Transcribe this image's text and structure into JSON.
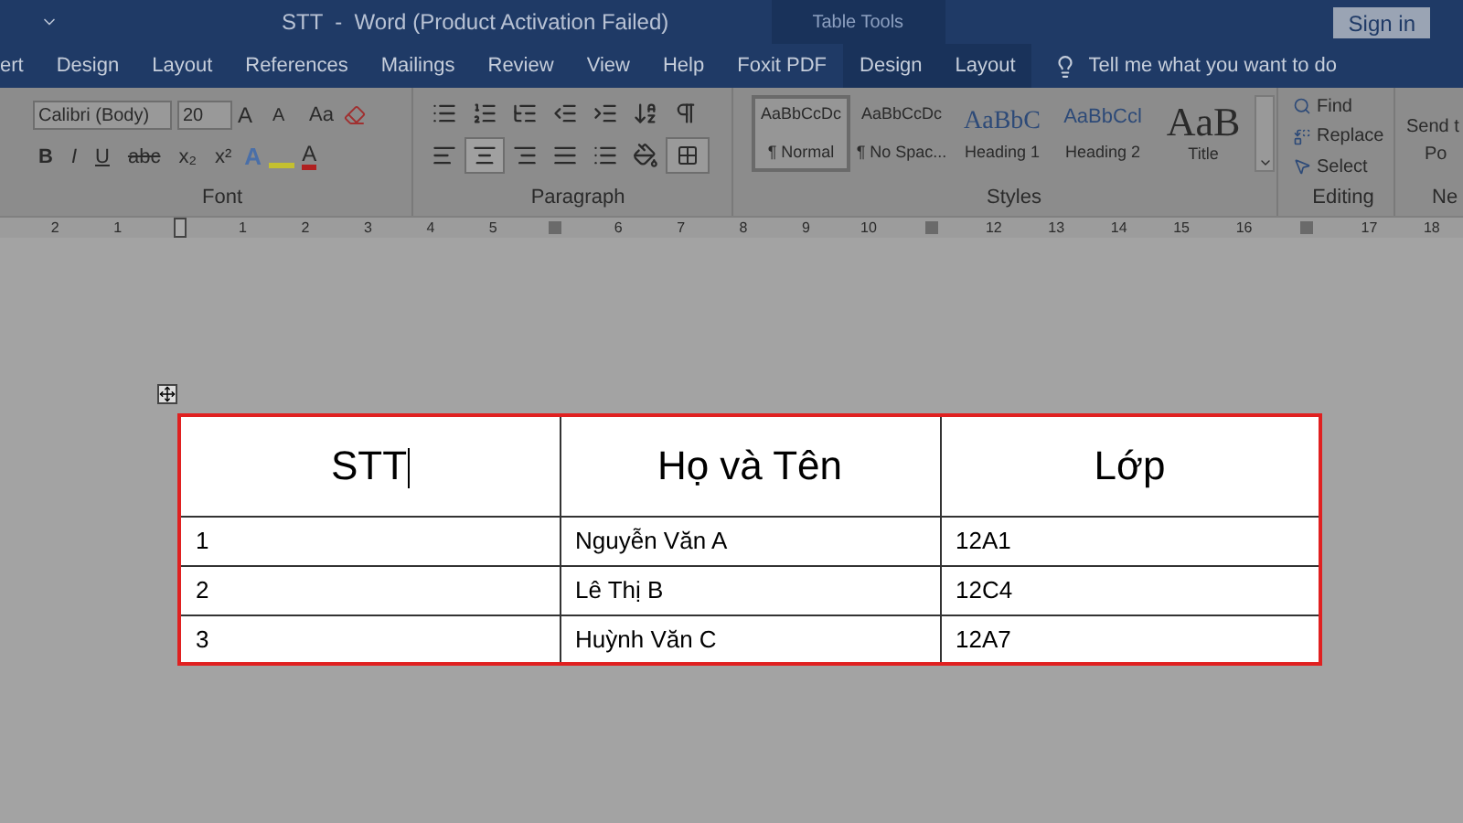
{
  "title_bar": {
    "title": "STT  -  Word (Product Activation Failed)",
    "context_label": "Table Tools",
    "sign_in": "Sign in"
  },
  "tabs": [
    {
      "label": "ert",
      "contextual": false,
      "selected": false
    },
    {
      "label": "Design",
      "contextual": false,
      "selected": false
    },
    {
      "label": "Layout",
      "contextual": false,
      "selected": false
    },
    {
      "label": "References",
      "contextual": false,
      "selected": false
    },
    {
      "label": "Mailings",
      "contextual": false,
      "selected": false
    },
    {
      "label": "Review",
      "contextual": false,
      "selected": false
    },
    {
      "label": "View",
      "contextual": false,
      "selected": false
    },
    {
      "label": "Help",
      "contextual": false,
      "selected": false
    },
    {
      "label": "Foxit PDF",
      "contextual": false,
      "selected": false
    },
    {
      "label": "Design",
      "contextual": true,
      "selected": false
    },
    {
      "label": "Layout",
      "contextual": true,
      "selected": false
    }
  ],
  "tell_me": {
    "placeholder": "Tell me what you want to do"
  },
  "font_group": {
    "label": "Font",
    "font_name": "Calibri (Body)",
    "font_size": "20",
    "case_button": "Aa",
    "letter_buttons": [
      "A",
      "A",
      "A",
      "A"
    ],
    "format_buttons": [
      "B",
      "I",
      "U",
      "abc",
      "x₂",
      "x²"
    ]
  },
  "paragraph_group": {
    "label": "Paragraph"
  },
  "styles_group": {
    "label": "Styles",
    "styles": [
      {
        "preview": "AaBbCcDc",
        "name": "¶ Normal",
        "kind": "body",
        "selected": true
      },
      {
        "preview": "AaBbCcDc",
        "name": "¶ No Spac...",
        "kind": "body",
        "selected": false
      },
      {
        "preview": "AaBbC",
        "name": "Heading 1",
        "kind": "heading1",
        "selected": false
      },
      {
        "preview": "AaBbCcl",
        "name": "Heading 2",
        "kind": "heading2",
        "selected": false
      },
      {
        "preview": "AaB",
        "name": "Title",
        "kind": "title",
        "selected": false
      }
    ]
  },
  "editing_group": {
    "label": "Editing",
    "commands": [
      "Find",
      "Replace",
      "Select"
    ]
  },
  "new_group": {
    "label": "Ne",
    "command_lines": [
      "Send t",
      "Po"
    ]
  },
  "ruler": {
    "marks": [
      {
        "kind": "number",
        "label": "2"
      },
      {
        "kind": "number",
        "label": "1"
      },
      {
        "kind": "indent"
      },
      {
        "kind": "number",
        "label": "1"
      },
      {
        "kind": "number",
        "label": "2"
      },
      {
        "kind": "number",
        "label": "3"
      },
      {
        "kind": "number",
        "label": "4"
      },
      {
        "kind": "number",
        "label": "5"
      },
      {
        "kind": "column"
      },
      {
        "kind": "number",
        "label": "6"
      },
      {
        "kind": "number",
        "label": "7"
      },
      {
        "kind": "number",
        "label": "8"
      },
      {
        "kind": "number",
        "label": "9"
      },
      {
        "kind": "number",
        "label": "10"
      },
      {
        "kind": "column"
      },
      {
        "kind": "number",
        "label": "12"
      },
      {
        "kind": "number",
        "label": "13"
      },
      {
        "kind": "number",
        "label": "14"
      },
      {
        "kind": "number",
        "label": "15"
      },
      {
        "kind": "number",
        "label": "16"
      },
      {
        "kind": "column"
      },
      {
        "kind": "number",
        "label": "17"
      },
      {
        "kind": "number",
        "label": "18"
      }
    ]
  },
  "table": {
    "columns": [
      "STT",
      "Họ và Tên",
      "Lớp"
    ],
    "rows": [
      [
        "1",
        "Nguyễn Văn A",
        "12A1"
      ],
      [
        "2",
        "Lê Thị B",
        "12C4"
      ],
      [
        "3",
        "Huỳnh Văn C",
        "12A7"
      ]
    ]
  }
}
